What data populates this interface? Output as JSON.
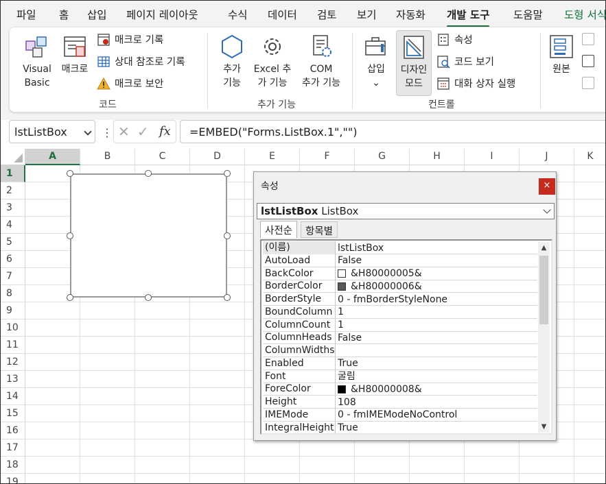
{
  "menu": {
    "tabs": [
      "파일",
      "홈",
      "삽입",
      "페이지 레이아웃",
      "수식",
      "데이터",
      "검토",
      "보기",
      "자동화",
      "개발 도구",
      "도움말",
      "도형 서식"
    ],
    "active_tab": "개발 도구"
  },
  "ribbon": {
    "code_group": {
      "visual_basic_l1": "Visual",
      "visual_basic_l2": "Basic",
      "macros": "매크로",
      "record_macro": "매크로 기록",
      "relative_refs": "상대 참조로 기록",
      "macro_security": "매크로 보안",
      "label": "코드"
    },
    "addins_group": {
      "addins_l1": "추가",
      "addins_l2": "기능",
      "excel_addins_l1": "Excel 추",
      "excel_addins_l2": "가 기능",
      "com_addins_l1": "COM",
      "com_addins_l2": "추가 기능",
      "label": "추가 기능"
    },
    "controls_group": {
      "insert": "삽입",
      "design_mode_l1": "디자인",
      "design_mode_l2": "모드",
      "properties": "속성",
      "view_code": "코드 보기",
      "run_dialog": "대화 상자 실행",
      "label": "컨트롤"
    },
    "xml_group": {
      "source": "원본"
    }
  },
  "formula_bar": {
    "name_box": "lstListBox",
    "fx": "fx",
    "formula": "=EMBED(\"Forms.ListBox.1\",\"\")"
  },
  "sheet": {
    "columns": [
      "A",
      "B",
      "C",
      "D",
      "E",
      "F",
      "G",
      "H",
      "I",
      "J",
      "K"
    ],
    "rows": [
      "1",
      "2",
      "3",
      "4",
      "5",
      "6",
      "7",
      "8",
      "9",
      "10",
      "11",
      "12",
      "13",
      "14",
      "15",
      "16",
      "17",
      "18",
      "19"
    ],
    "selected_column": "A",
    "selected_row": "1"
  },
  "properties_window": {
    "title": "속성",
    "close": "×",
    "object_name": "lstListBox",
    "object_type": "ListBox",
    "tab_alpha": "사전순",
    "tab_category": "항목별",
    "rows": [
      {
        "name": "(이름)",
        "value": "lstListBox"
      },
      {
        "name": "AutoLoad",
        "value": "False"
      },
      {
        "name": "BackColor",
        "value": "&H80000005&",
        "swatch": "#ffffff"
      },
      {
        "name": "BorderColor",
        "value": "&H80000006&",
        "swatch": "#595959"
      },
      {
        "name": "BorderStyle",
        "value": "0 - fmBorderStyleNone"
      },
      {
        "name": "BoundColumn",
        "value": "1"
      },
      {
        "name": "ColumnCount",
        "value": "1"
      },
      {
        "name": "ColumnHeads",
        "value": "False"
      },
      {
        "name": "ColumnWidths",
        "value": ""
      },
      {
        "name": "Enabled",
        "value": "True"
      },
      {
        "name": "Font",
        "value": "굴림"
      },
      {
        "name": "ForeColor",
        "value": "&H80000008&",
        "swatch": "#000000"
      },
      {
        "name": "Height",
        "value": "108"
      },
      {
        "name": "IMEMode",
        "value": "0 - fmIMEModeNoControl"
      },
      {
        "name": "IntegralHeight",
        "value": "True"
      }
    ]
  },
  "colors": {
    "excel_green": "#217346",
    "close_red": "#c42b1c"
  }
}
